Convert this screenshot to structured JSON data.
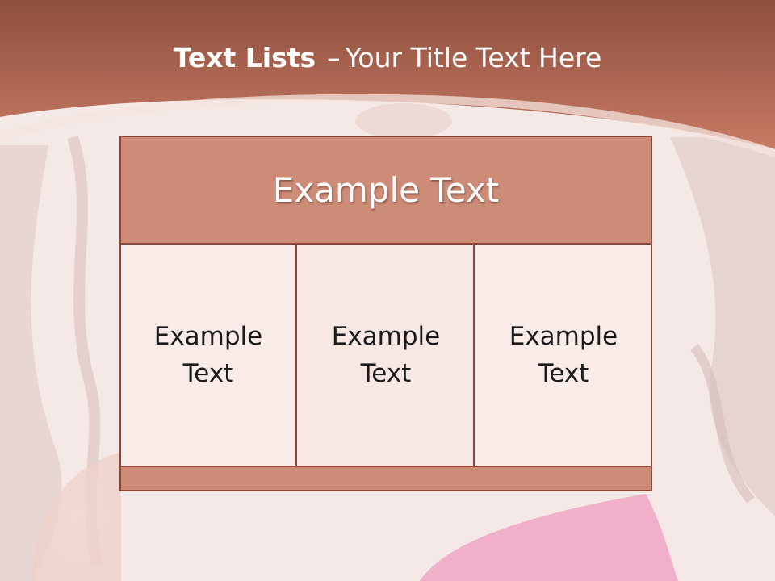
{
  "slide": {
    "title_bold": "Text Lists",
    "title_dash": "–",
    "title_rest": "Your Title Text Here",
    "colors": {
      "header": "#cd8c78",
      "border": "#8b4636",
      "banner": "#b86a55"
    },
    "table": {
      "header": "Example Text",
      "columns": [
        {
          "line1": "Example",
          "line2": "Text"
        },
        {
          "line1": "Example",
          "line2": "Text"
        },
        {
          "line1": "Example",
          "line2": "Text"
        }
      ]
    }
  }
}
